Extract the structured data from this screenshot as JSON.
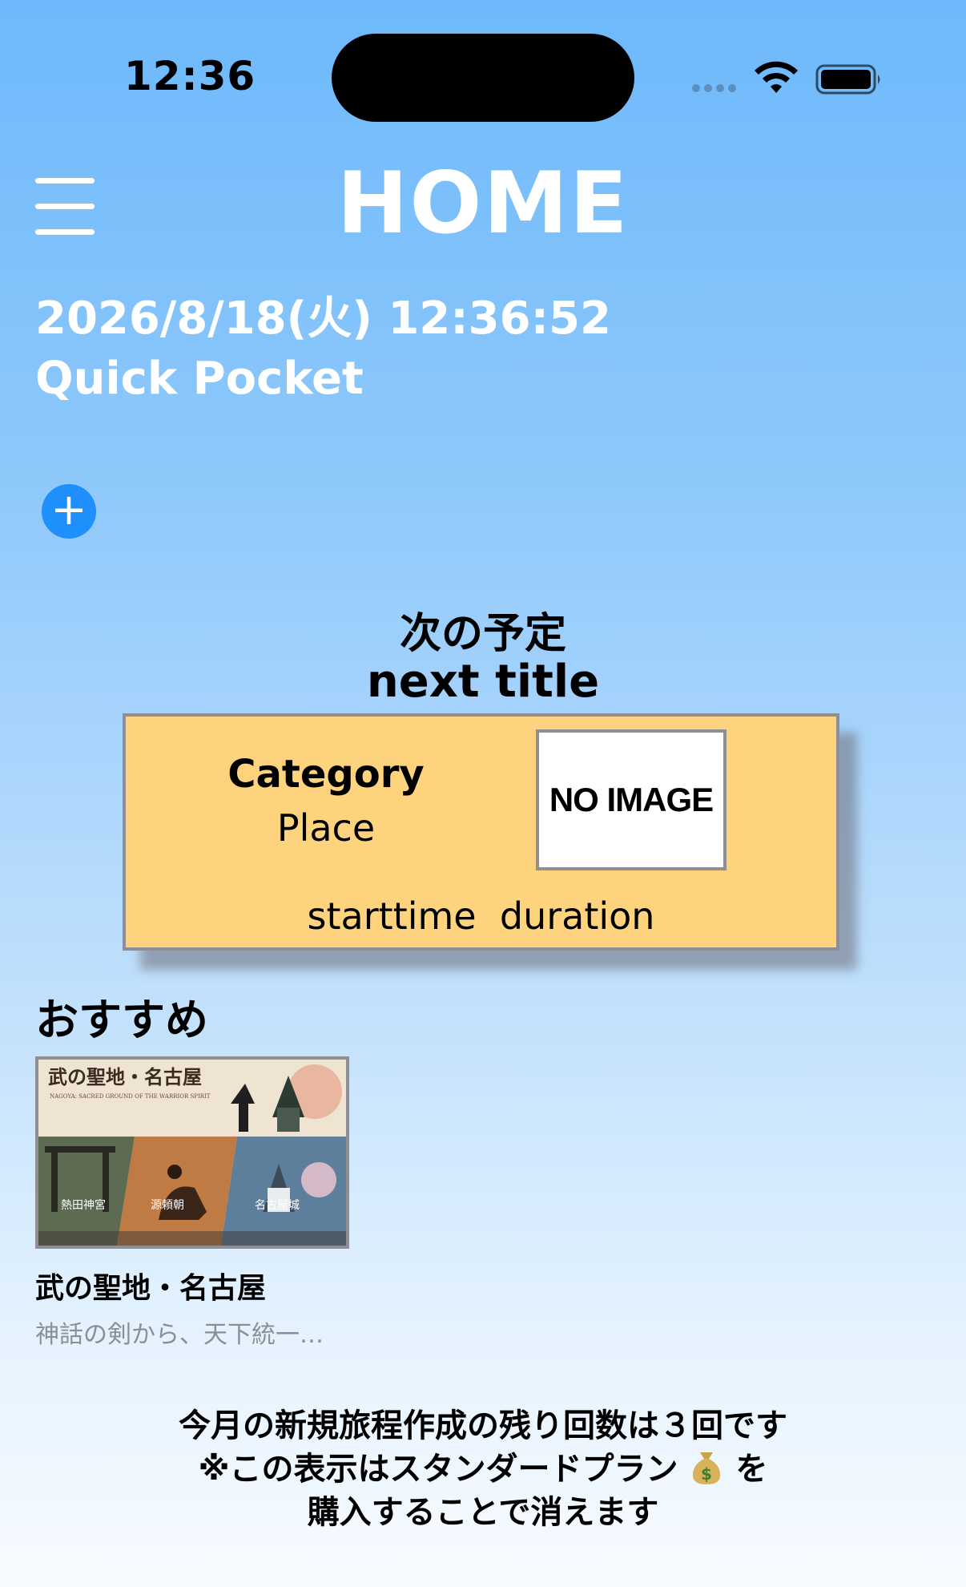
{
  "status_bar": {
    "time": "12:36",
    "icons": [
      "cellular-dots-icon",
      "wifi-icon",
      "battery-icon"
    ]
  },
  "header": {
    "menu_icon": "hamburger-menu-icon",
    "title": "HOME",
    "datetime": "2026/8/18(火) 12:36:52",
    "app_name": "Quick Pocket",
    "add_label": "+"
  },
  "next_schedule": {
    "label": "次の予定",
    "title": "next title",
    "card": {
      "category": "Category",
      "place": "Place",
      "image_placeholder": "NO IMAGE",
      "starttime": "starttime",
      "duration": "duration",
      "background_color": "#fed37e"
    }
  },
  "recommend": {
    "heading": "おすすめ",
    "items": [
      {
        "title": "武の聖地・名古屋",
        "description": "神話の剣から、天下統一…",
        "thumbnail": {
          "headline": "武の聖地・名古屋",
          "subtitle": "NAGOYA: SACRED GROUND OF THE WARRIOR SPIRIT",
          "panels": [
            "熱田神宮",
            "源頼朝",
            "名古屋城"
          ]
        }
      }
    ]
  },
  "notice": {
    "line1": "今月の新規旅程作成の残り回数は３回です",
    "line2a": "※この表示はスタンダードプラン",
    "line2b": "を",
    "line3": "購入することで消えます",
    "icon": "money-bag-icon"
  },
  "colors": {
    "accent": "#1f8ffb",
    "card": "#fed37e",
    "gradient_top": "#6db9fb",
    "gradient_bottom": "#f7fbff"
  }
}
